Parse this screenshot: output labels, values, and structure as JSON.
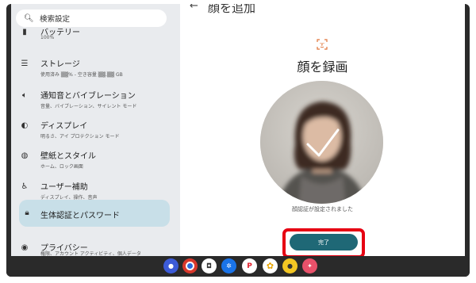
{
  "search": {
    "placeholder": "検索設定"
  },
  "sidebar": {
    "items": [
      {
        "title": "バッテリー",
        "subtitle": "100%",
        "icon": "battery-icon"
      },
      {
        "title": "ストレージ",
        "subtitle": "使用済み ▒▒% - 空き容量 ▒▒.▒▒ GB",
        "icon": "storage-icon"
      },
      {
        "title": "通知音とバイブレーション",
        "subtitle": "音量、バイブレーション、サイレント モード",
        "icon": "volume-icon"
      },
      {
        "title": "ディスプレイ",
        "subtitle": "明るさ、アイ プロテクション モード",
        "icon": "brightness-icon"
      },
      {
        "title": "壁紙とスタイル",
        "subtitle": "ホーム、ロック画面",
        "icon": "palette-icon"
      },
      {
        "title": "ユーザー補助",
        "subtitle": "ディスプレイ、操作、音声",
        "icon": "accessibility-icon"
      },
      {
        "title": "生体認証とパスワード",
        "subtitle": "",
        "icon": "lock-icon"
      },
      {
        "title": "プライバシー",
        "subtitle": "権限、アカウント アクティビティ、個人データ",
        "icon": "privacy-icon"
      }
    ]
  },
  "page": {
    "title": "顔を追加",
    "heading": "顔を録画",
    "status": "顔認証が設定されました",
    "done_label": "完了"
  },
  "colors": {
    "accent": "#1f6876",
    "highlight": "#e60012",
    "active_bg": "#c8dfe8"
  },
  "dock": {
    "apps": [
      "assistant-icon",
      "chrome-icon",
      "camera-icon",
      "settings-icon",
      "rakuten-pay-icon",
      "photos-icon",
      "gallery-icon",
      "apps-icon"
    ]
  }
}
